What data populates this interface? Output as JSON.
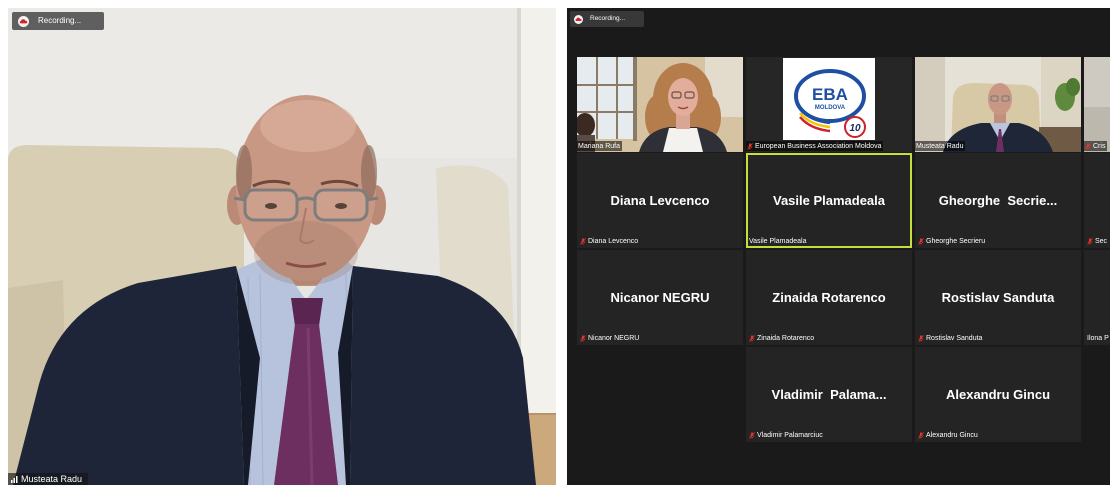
{
  "speaker_view": {
    "recording_label": "Recording...",
    "participant_name": "Musteata Radu"
  },
  "gallery": {
    "recording_label": "Recording...",
    "tiles": [
      {
        "label": "Mariana Rufa",
        "muted": false
      },
      {
        "label": "European Business Association Moldova",
        "muted": true,
        "logo": {
          "title": "EBA",
          "subtitle": "MOLDOVA",
          "badge": "10"
        }
      },
      {
        "label": "Musteata Radu",
        "muted": false
      },
      {
        "label": "Cris",
        "muted": true
      },
      {
        "display_name": "Diana Levcenco",
        "label": "Diana Levcenco",
        "muted": true
      },
      {
        "display_name": "Vasile Plamadeala",
        "label": "Vasile Plamadeala",
        "muted": false,
        "active": true
      },
      {
        "display_name": "Gheorghe  Secrie...",
        "label": "Gheorghe Secrieru",
        "muted": true
      },
      {
        "label": "Sec",
        "muted": true
      },
      {
        "display_name": "Nicanor NEGRU",
        "label": "Nicanor NEGRU",
        "muted": true
      },
      {
        "display_name": "Zinaida Rotarenco",
        "label": "Zinaida Rotarenco",
        "muted": true
      },
      {
        "display_name": "Rostislav Sanduta",
        "label": "Rostislav Sanduta",
        "muted": true
      },
      {
        "label": "Ilona P",
        "muted": false
      },
      {
        "display_name": "Vladimir  Palama...",
        "label": "Vladimir Palamarciuc",
        "muted": true
      },
      {
        "display_name": "Alexandru Gincu",
        "label": "Alexandru Gincu",
        "muted": true
      }
    ]
  },
  "icons": {
    "recording": "cloud-record-icon",
    "muted_mic": "mic-muted-icon",
    "connection": "signal-bars-icon"
  },
  "colors": {
    "active_speaker_border": "#c9dc3e",
    "muted_mic": "#e5352d",
    "gallery_background": "#1a1a1a",
    "tile_background": "#242424",
    "eba_blue": "#1f4fa3"
  }
}
